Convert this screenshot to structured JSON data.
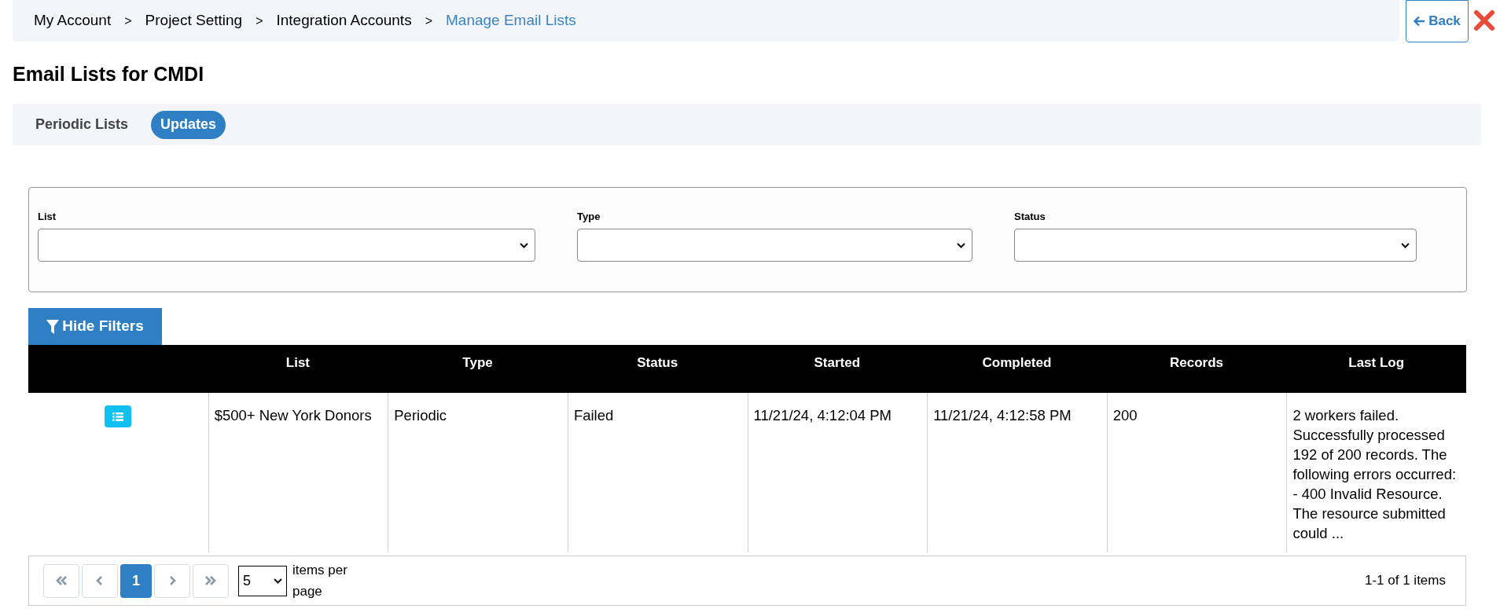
{
  "breadcrumb": [
    {
      "kind": "link",
      "label": "My Account",
      "current": false
    },
    {
      "kind": "separator",
      "label": ">"
    },
    {
      "kind": "link",
      "label": "Project Setting",
      "current": false
    },
    {
      "kind": "separator",
      "label": ">"
    },
    {
      "kind": "link",
      "label": "Integration Accounts",
      "current": false
    },
    {
      "kind": "separator",
      "label": ">"
    },
    {
      "kind": "link",
      "label": "Manage Email Lists",
      "current": true
    }
  ],
  "back_button": {
    "label": "Back"
  },
  "title": "Email Lists for CMDI",
  "tabs": [
    {
      "label": "Periodic Lists",
      "selected": false
    },
    {
      "label": "Updates",
      "selected": true
    }
  ],
  "filters": [
    {
      "label": "List"
    },
    {
      "label": "Type"
    },
    {
      "label": "Status"
    }
  ],
  "hide_filters_button": {
    "label": "Hide Filters"
  },
  "table": {
    "columns": [
      "List",
      "Type",
      "Status",
      "Started",
      "Completed",
      "Records",
      "Last Log"
    ],
    "rows": [
      {
        "list": "$500+ New York Donors",
        "type": "Periodic",
        "status": "Failed",
        "started": "11/21/24, 4:12:04 PM",
        "completed": "11/21/24, 4:12:58 PM",
        "records": "200",
        "last_log": "2 workers failed. Successfully processed 192 of 200 records. The following errors occurred: - 400 Invalid Resource. The resource submitted could ..."
      }
    ]
  },
  "pager": {
    "pages": [
      {
        "label": "1",
        "selected": true
      }
    ],
    "page_size": "5",
    "page_size_label": "items per page",
    "summary": "1-1 of 1 items"
  }
}
